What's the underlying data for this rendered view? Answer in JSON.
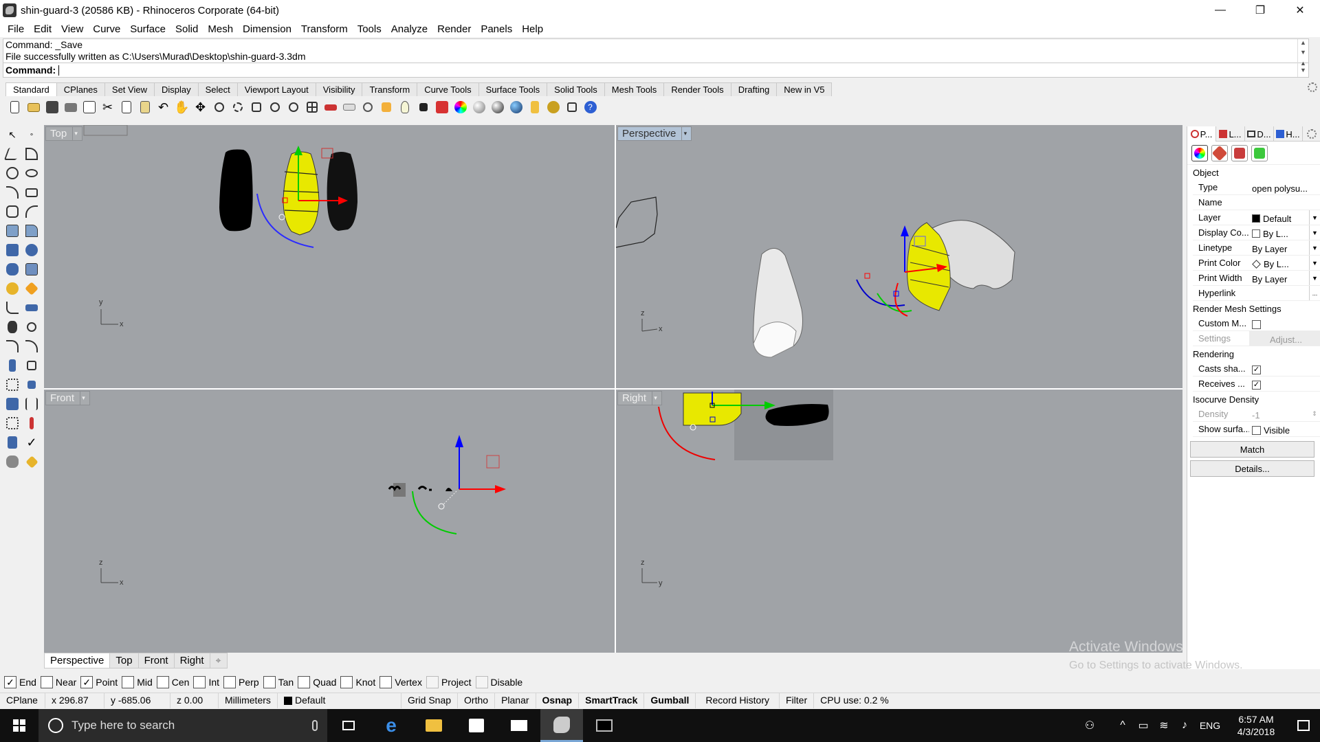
{
  "window": {
    "title": "shin-guard-3 (20586 KB) - Rhinoceros Corporate (64-bit)",
    "minimize": "—",
    "maximize": "❐",
    "close": "✕"
  },
  "menu": [
    "File",
    "Edit",
    "View",
    "Curve",
    "Surface",
    "Solid",
    "Mesh",
    "Dimension",
    "Transform",
    "Tools",
    "Analyze",
    "Render",
    "Panels",
    "Help"
  ],
  "command": {
    "history": [
      "Command: _Save",
      "File successfully written as C:\\Users\\Murad\\Desktop\\shin-guard-3.3dm"
    ],
    "prompt": "Command:"
  },
  "tool_tabs": [
    "Standard",
    "CPlanes",
    "Set View",
    "Display",
    "Select",
    "Viewport Layout",
    "Visibility",
    "Transform",
    "Curve Tools",
    "Surface Tools",
    "Solid Tools",
    "Mesh Tools",
    "Render Tools",
    "Drafting",
    "New in V5"
  ],
  "viewports": {
    "top": {
      "label": "Top",
      "axis_x": "x",
      "axis_y": "y"
    },
    "perspective": {
      "label": "Perspective",
      "axis_x": "x",
      "axis_y": "z"
    },
    "front": {
      "label": "Front",
      "axis_x": "x",
      "axis_y": "z"
    },
    "right": {
      "label": "Right",
      "axis_x": "y",
      "axis_y": "z"
    }
  },
  "viewport_tabs": [
    "Perspective",
    "Top",
    "Front",
    "Right"
  ],
  "viewport_tab_add": "⌖",
  "osnaps": [
    {
      "label": "End",
      "checked": true
    },
    {
      "label": "Near",
      "checked": false
    },
    {
      "label": "Point",
      "checked": true
    },
    {
      "label": "Mid",
      "checked": false
    },
    {
      "label": "Cen",
      "checked": false
    },
    {
      "label": "Int",
      "checked": false
    },
    {
      "label": "Perp",
      "checked": false
    },
    {
      "label": "Tan",
      "checked": false
    },
    {
      "label": "Quad",
      "checked": false
    },
    {
      "label": "Knot",
      "checked": false
    },
    {
      "label": "Vertex",
      "checked": false
    },
    {
      "label": "Project",
      "checked": false,
      "disabled": true
    },
    {
      "label": "Disable",
      "checked": false,
      "disabled": true
    }
  ],
  "status": {
    "cplane": "CPlane",
    "x": "x 296.87",
    "y": "y -685.06",
    "z": "z 0.00",
    "units": "Millimeters",
    "layer": "Default",
    "grid_snap": "Grid Snap",
    "ortho": "Ortho",
    "planar": "Planar",
    "osnap": "Osnap",
    "smarttrack": "SmartTrack",
    "gumball": "Gumball",
    "record_history": "Record History",
    "filter": "Filter",
    "cpu": "CPU use: 0.2 %"
  },
  "panel": {
    "tabs": [
      "P...",
      "L...",
      "D...",
      "H..."
    ],
    "object_section": "Object",
    "properties": [
      {
        "key": "Type",
        "value": "open polysu...",
        "dropdown": false
      },
      {
        "key": "Name",
        "value": "",
        "dropdown": false
      },
      {
        "key": "Layer",
        "value": "Default",
        "dropdown": true,
        "swatch": "#000000"
      },
      {
        "key": "Display Co...",
        "value": "By L...",
        "dropdown": true,
        "swatch": "#ffffff"
      },
      {
        "key": "Linetype",
        "value": "By Layer",
        "dropdown": true
      },
      {
        "key": "Print Color",
        "value": "By L...",
        "dropdown": true,
        "diamond": true
      },
      {
        "key": "Print Width",
        "value": "By Layer",
        "dropdown": true
      },
      {
        "key": "Hyperlink",
        "value": "",
        "dropdown": false,
        "ellipsis": "..."
      }
    ],
    "render_mesh_section": "Render Mesh Settings",
    "custom_mesh_label": "Custom M...",
    "settings_label": "Settings",
    "adjust_label": "Adjust...",
    "rendering_section": "Rendering",
    "casts_label": "Casts sha...",
    "receives_label": "Receives ...",
    "isocurve_section": "Isocurve Density",
    "density_label": "Density",
    "density_value": "-1",
    "show_surface_label": "Show surfa...",
    "visible_label": "Visible",
    "match_label": "Match",
    "details_label": "Details..."
  },
  "watermark": {
    "title": "Activate Windows",
    "subtitle": "Go to Settings to activate Windows."
  },
  "taskbar": {
    "search_placeholder": "Type here to search",
    "language": "ENG",
    "time": "6:57 AM",
    "date": "4/3/2018"
  }
}
